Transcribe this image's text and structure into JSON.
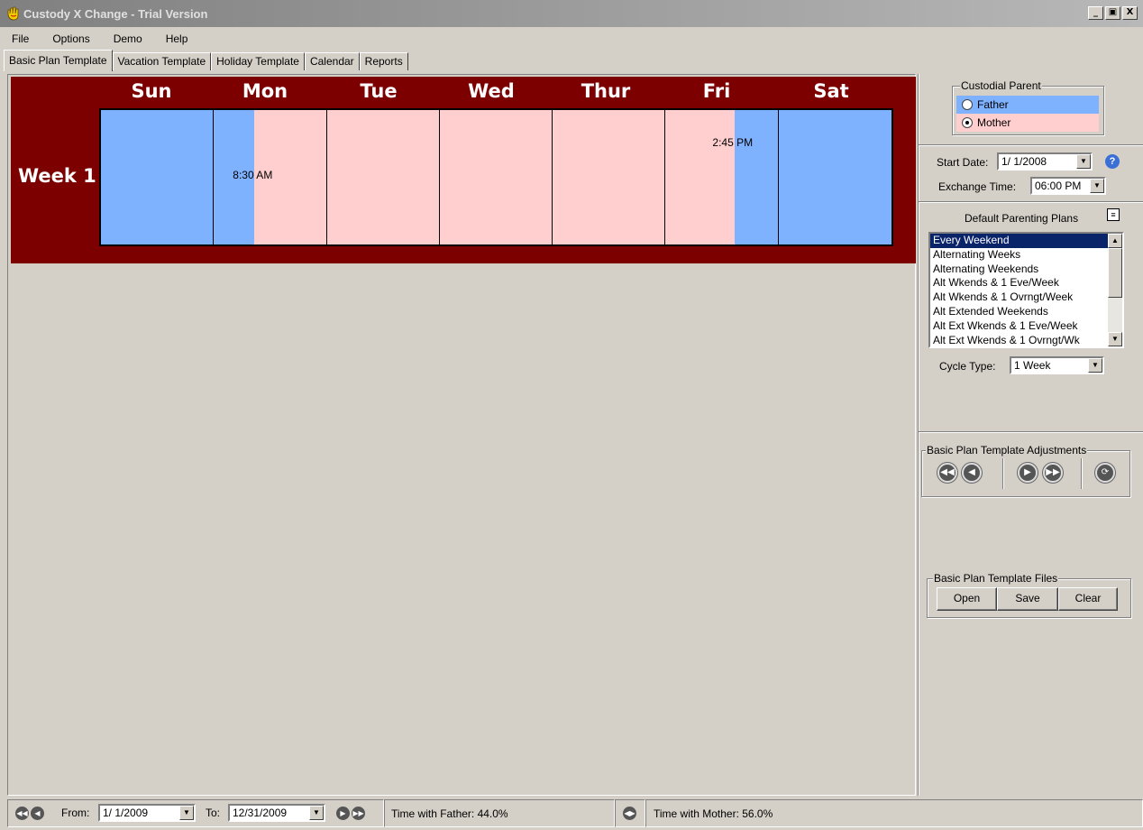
{
  "window": {
    "title": "Custody X Change - Trial Version",
    "minimize": "_",
    "restore": "̅⃞",
    "close": "X"
  },
  "menu": [
    "File",
    "Options",
    "Demo",
    "Help"
  ],
  "tabs": [
    "Basic Plan Template",
    "Vacation Template",
    "Holiday Template",
    "Calendar",
    "Reports"
  ],
  "calendar": {
    "days": [
      "Sun",
      "Mon",
      "Tue",
      "Wed",
      "Thur",
      "Fri",
      "Sat"
    ],
    "week_label": "Week 1",
    "mon_time": "8:30 AM",
    "fri_time": "2:45 PM",
    "colors": {
      "father": "#7fb2fe",
      "mother": "#ffcece",
      "background": "#7c0000"
    }
  },
  "custodial": {
    "legend": "Custodial Parent",
    "father": "Father",
    "mother": "Mother",
    "selected": "Mother"
  },
  "settings": {
    "start_date_label": "Start Date:",
    "start_date": "1/ 1/2008",
    "exchange_time_label": "Exchange Time:",
    "exchange_time": "06:00 PM"
  },
  "plans": {
    "title": "Default Parenting Plans",
    "items": [
      "Every Weekend",
      "Alternating Weeks",
      "Alternating Weekends",
      "Alt Wkends & 1 Eve/Week",
      "Alt Wkends & 1 Ovrngt/Week",
      "Alt Extended Weekends",
      "Alt Ext Wkends & 1 Eve/Week",
      "Alt Ext Wkends & 1 Ovrngt/Wk"
    ],
    "selected": "Every Weekend",
    "cycle_label": "Cycle Type:",
    "cycle_value": "1 Week"
  },
  "adjustments": {
    "legend": "Basic Plan Template Adjustments"
  },
  "files": {
    "legend": "Basic Plan Template Files",
    "open": "Open",
    "save": "Save",
    "clear": "Clear"
  },
  "status": {
    "from_label": "From:",
    "from": "1/ 1/2009",
    "to_label": "To:",
    "to": "12/31/2009",
    "father_time": "Time with Father: 44.0%",
    "mother_time": "Time with Mother: 56.0%"
  }
}
